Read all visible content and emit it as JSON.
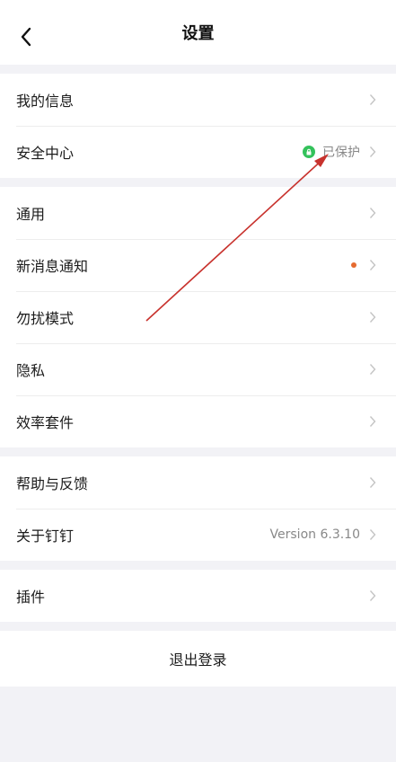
{
  "nav": {
    "title": "设置",
    "back_icon": "back-arrow-icon"
  },
  "groups": [
    {
      "items": [
        {
          "label": "我的信息"
        },
        {
          "label": "安全中心",
          "status": "已保护"
        }
      ]
    },
    {
      "items": [
        {
          "label": "通用"
        },
        {
          "label": "新消息通知",
          "has_dot": true
        },
        {
          "label": "勿扰模式"
        },
        {
          "label": "隐私"
        },
        {
          "label": "效率套件"
        }
      ]
    },
    {
      "items": [
        {
          "label": "帮助与反馈"
        },
        {
          "label": "关于钉钉",
          "value": "Version 6.3.10"
        }
      ]
    },
    {
      "items": [
        {
          "label": "插件"
        }
      ]
    }
  ],
  "logout_label": "退出登录",
  "colors": {
    "protected_badge": "#34c25b",
    "notify_dot": "#e56a2f",
    "annotation_arrow": "#c8322d"
  }
}
